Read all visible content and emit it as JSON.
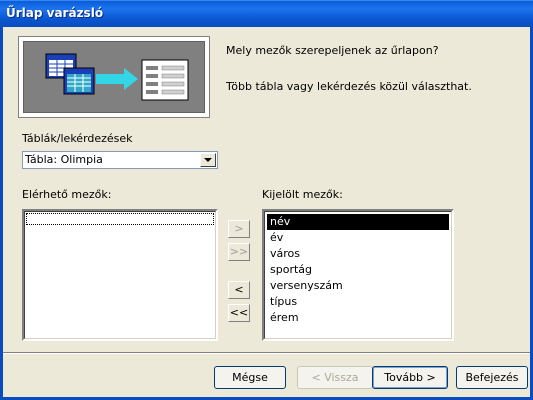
{
  "window": {
    "title": "Űrlap varázsló"
  },
  "header": {
    "question": "Mely mezők szerepeljenek az űrlapon?",
    "hint": "Több tábla vagy lekérdezés közül választhat."
  },
  "source": {
    "label": "Táblák/lekérdezések",
    "selected": "Tábla: Olimpia"
  },
  "available": {
    "label": "Elérhető mezők:",
    "items": []
  },
  "selected_fields": {
    "label": "Kijelölt mezők:",
    "items": [
      "név",
      "év",
      "város",
      "sportág",
      "versenyszám",
      "típus",
      "érem"
    ],
    "highlighted_index": 0
  },
  "move_buttons": {
    "add_one": ">",
    "add_all": ">>",
    "remove_one": "<",
    "remove_all": "<<"
  },
  "footer": {
    "cancel": "Mégse",
    "back": "< Vissza",
    "next": "Tovább >",
    "finish": "Befejezés"
  },
  "colors": {
    "title_bar": "#0a5fd8",
    "dialog_bg": "#ece9d8",
    "selection_bg": "#000000"
  },
  "icons": [
    "tables-to-form-illustration",
    "combo-dropdown-arrow"
  ]
}
